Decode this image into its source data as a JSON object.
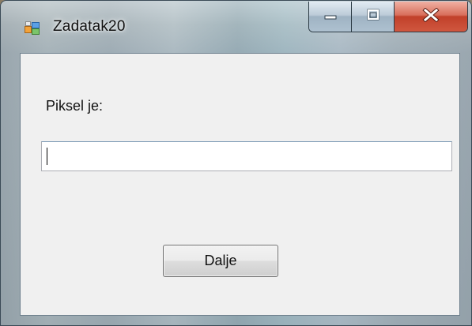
{
  "window": {
    "title": "Zadatak20",
    "icons": {
      "app": "app-window-icon",
      "minimize": "minimize-icon",
      "maximize": "maximize-icon",
      "close": "close-icon"
    },
    "colors": {
      "close_button": "#c1402a",
      "client_background": "#f0f0f0"
    }
  },
  "form": {
    "label": "Piksel je:",
    "input_value": "",
    "button_label": "Dalje"
  }
}
